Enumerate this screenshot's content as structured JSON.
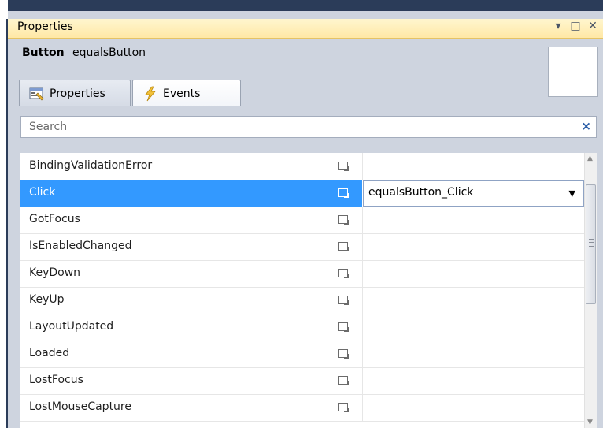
{
  "window": {
    "title": "Properties",
    "controls": {
      "dropdown": "▾",
      "maximize": "□",
      "close": "✕"
    }
  },
  "header": {
    "object_type": "Button",
    "object_name": "equalsButton"
  },
  "tabs": [
    {
      "label": "Properties",
      "icon": "properties-icon",
      "active": false
    },
    {
      "label": "Events",
      "icon": "lightning-icon",
      "active": true
    }
  ],
  "search": {
    "placeholder": "Search",
    "value": "",
    "clear_glyph": "×"
  },
  "events": [
    {
      "name": "BindingValidationError",
      "handler": ""
    },
    {
      "name": "Click",
      "handler": "equalsButton_Click",
      "selected": true
    },
    {
      "name": "GotFocus",
      "handler": ""
    },
    {
      "name": "IsEnabledChanged",
      "handler": ""
    },
    {
      "name": "KeyDown",
      "handler": ""
    },
    {
      "name": "KeyUp",
      "handler": ""
    },
    {
      "name": "LayoutUpdated",
      "handler": ""
    },
    {
      "name": "Loaded",
      "handler": ""
    },
    {
      "name": "LostFocus",
      "handler": ""
    },
    {
      "name": "LostMouseCapture",
      "handler": ""
    }
  ],
  "colors": {
    "selection": "#3399ff",
    "titlebar": "#ffe8a6",
    "panel": "#ced4df",
    "frame": "#2b3c59"
  }
}
